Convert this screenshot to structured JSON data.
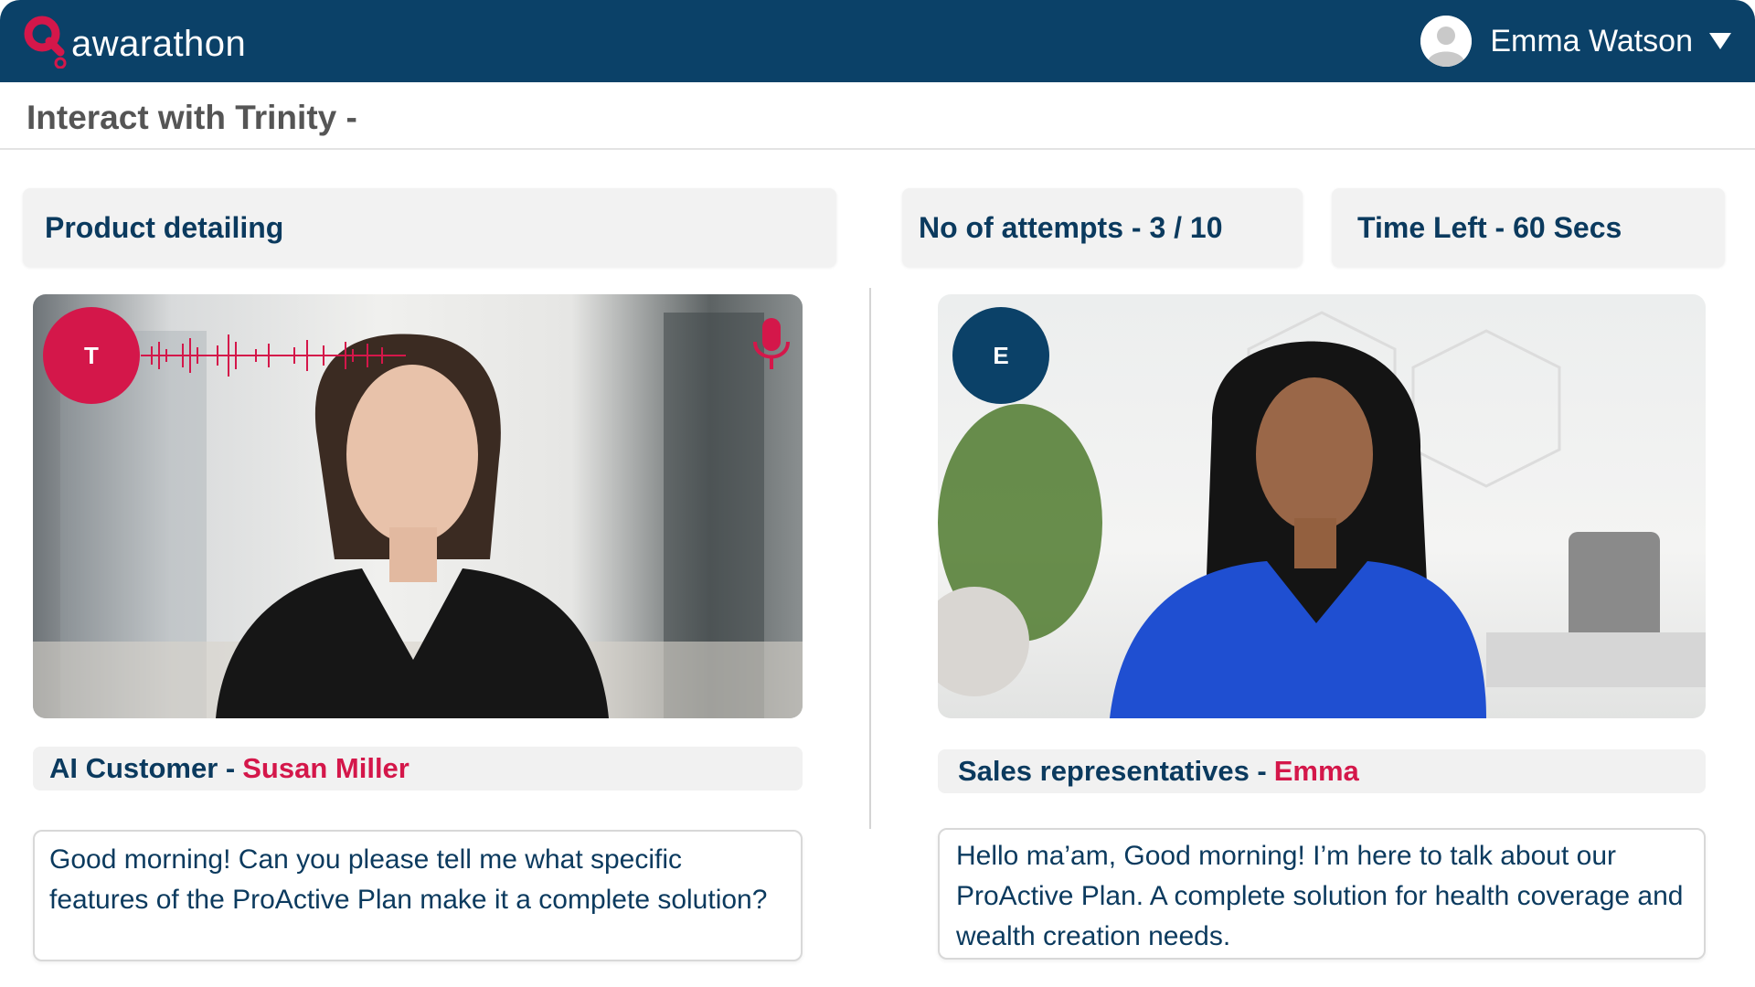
{
  "header": {
    "brand": "awarathon",
    "user_name": "Emma Watson"
  },
  "page": {
    "title": "Interact with Trinity -"
  },
  "info": {
    "topic": "Product detailing",
    "attempts": "No of attempts - 3 / 10",
    "time_left": "Time Left - 60 Secs"
  },
  "left_panel": {
    "badge": "T",
    "role": "AI Customer -",
    "name": "Susan Miller",
    "message": "Good morning! Can you please tell me what specific features of the ProActive Plan make it a complete solution?"
  },
  "right_panel": {
    "badge": "E",
    "role": "Sales representatives -",
    "name": "Emma",
    "message": "Hello ma’am, Good morning! I’m here to talk about our ProActive Plan. A complete solution for health coverage and wealth creation needs."
  },
  "colors": {
    "brand_navy": "#0b4168",
    "accent_red": "#d4174a",
    "text_navy": "#0b3a5e"
  },
  "icons": [
    "logo-icon",
    "user-avatar-icon",
    "dropdown-caret-icon",
    "audio-wave-icon",
    "microphone-icon"
  ]
}
